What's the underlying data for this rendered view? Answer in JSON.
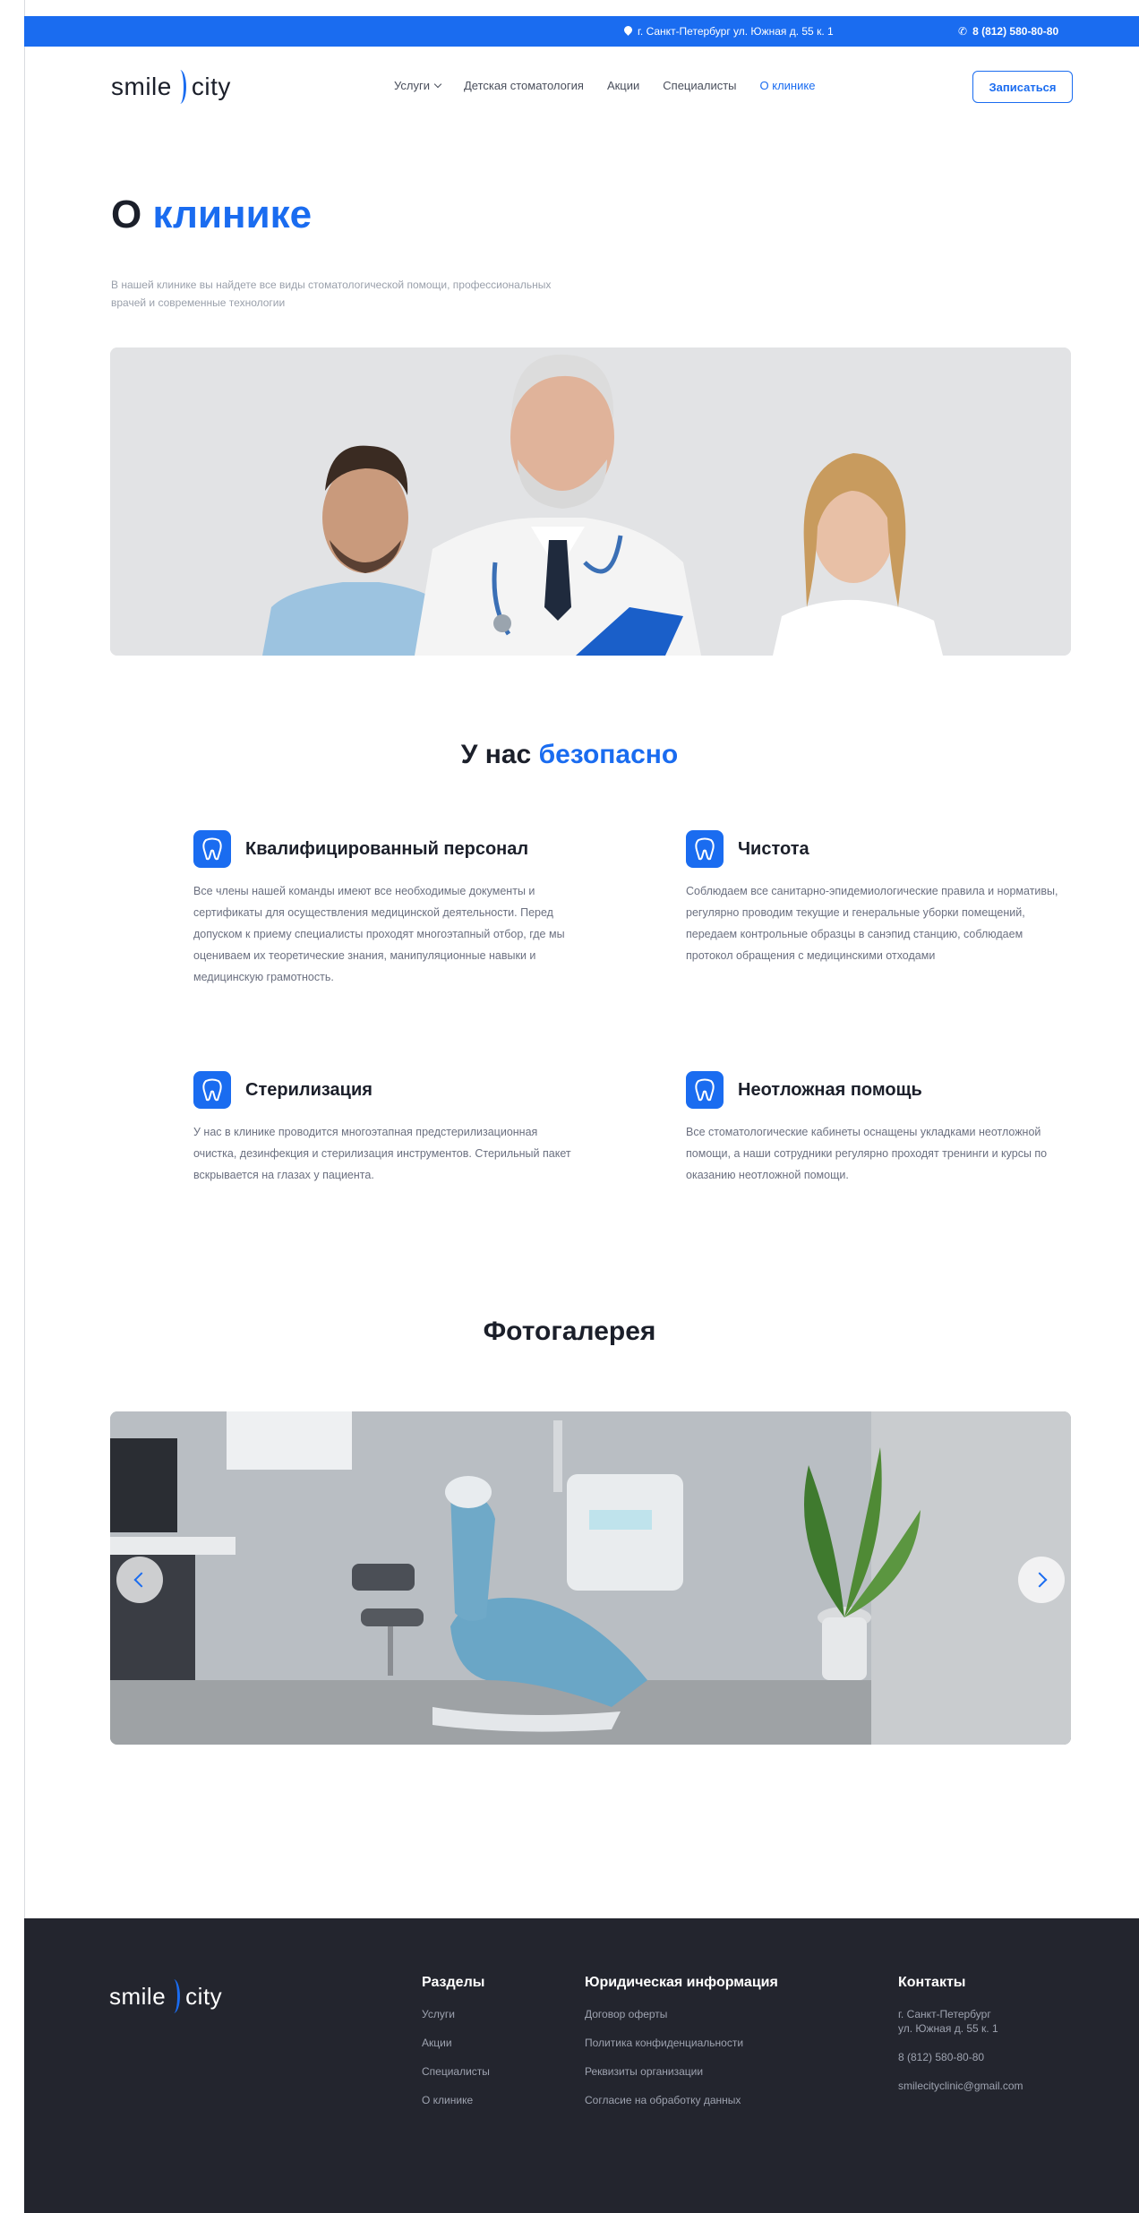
{
  "topbar": {
    "address": "г. Санкт-Петербург ул. Южная д. 55 к. 1",
    "phone": "8 (812) 580-80-80",
    "bg_color": "#1a6cf0"
  },
  "header": {
    "logo_left": "smile",
    "logo_right": "city",
    "nav": [
      "Услуги",
      "Детская стоматология",
      "Акции",
      "Специалисты",
      "О клинике"
    ],
    "active_nav": "О клинике",
    "cta": "Записаться"
  },
  "hero": {
    "title_plain": "О",
    "title_accent": "клинике",
    "subtitle": "В нашей клинике вы найдете все виды стоматологической помощи, профессиональных врачей и современные технологии"
  },
  "safety": {
    "title_plain": "У нас",
    "title_accent": "безопасно",
    "features": [
      {
        "icon": "tooth-icon",
        "title": "Квалифицированный персонал",
        "text": "Все члены нашей команды имеют все необходимые документы и сертификаты для осуществления медицинской деятельности. Перед допуском к приему специалисты проходят многоэтапный отбор, где мы оцениваем их теоретические знания, манипуляционные навыки и медицинскую грамотность."
      },
      {
        "icon": "tooth-icon",
        "title": "Чистота",
        "text": "Соблюдаем все санитарно-эпидемиологические правила и нормативы, регулярно проводим текущие и генеральные уборки помещений, передаем контрольные образцы в санэпид станцию, соблюдаем протокол обращения с медицинскими отходами"
      },
      {
        "icon": "tooth-icon",
        "title": "Стерилизация",
        "text": "У нас в клинике проводится многоэтапная предстерилизационная очистка, дезинфекция и стерилизация инструментов. Стерильный пакет вскрывается на глазах у пациента."
      },
      {
        "icon": "tooth-icon",
        "title": "Неотложная помощь",
        "text": "Все стоматологические кабинеты оснащены укладками неотложной помощи, а наши сотрудники регулярно проходят тренинги и курсы по оказанию неотложной помощи."
      }
    ]
  },
  "gallery": {
    "title": "Фотогалерея"
  },
  "footer": {
    "logo_left": "smile",
    "logo_right": "city",
    "sections": {
      "title": "Разделы",
      "links": [
        "Услуги",
        "Акции",
        "Специалисты",
        "О клинике"
      ]
    },
    "legal": {
      "title": "Юридическая информация",
      "links": [
        "Договор оферты",
        "Политика конфиденциальности",
        "Реквизиты организации",
        "Согласие на обработку данных"
      ]
    },
    "contacts": {
      "title": "Контакты",
      "address_line1": "г. Санкт-Петербург",
      "address_line2": "ул. Южная д. 55 к. 1",
      "phone": "8 (812) 580-80-80",
      "email": "smilecityclinic@gmail.com"
    }
  }
}
